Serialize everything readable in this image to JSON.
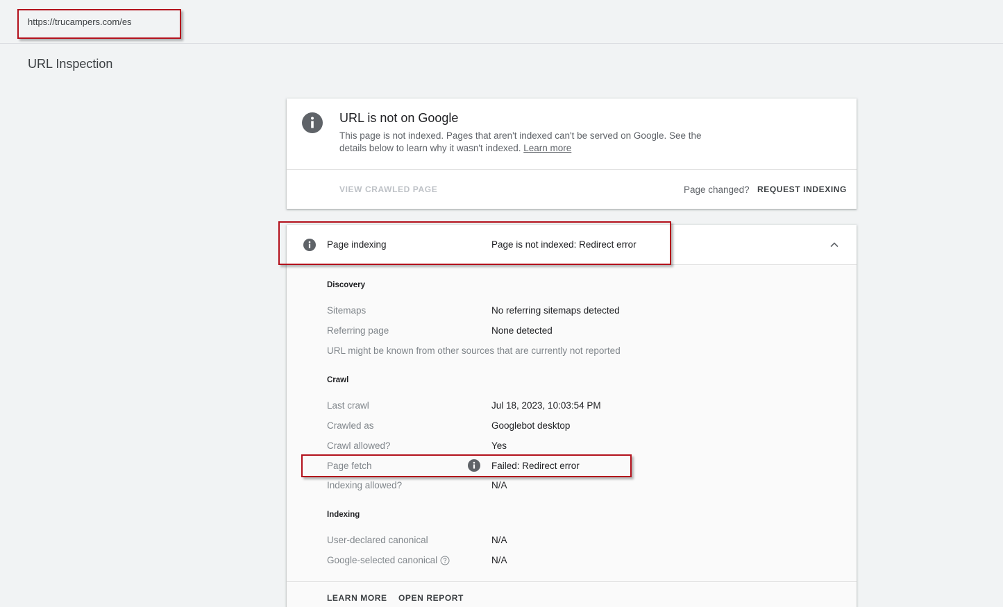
{
  "url_bar": {
    "value": "https://trucampers.com/es"
  },
  "page_title": "URL Inspection",
  "summary": {
    "heading": "URL is not on Google",
    "description": "This page is not indexed. Pages that aren't indexed can't be served on Google. See the details below to learn why it wasn't indexed.",
    "learn_more": "Learn more",
    "view_crawled": "VIEW CRAWLED PAGE",
    "page_changed": "Page changed?",
    "request_indexing": "REQUEST INDEXING",
    "icon": "info-icon"
  },
  "details": {
    "header_label": "Page indexing",
    "header_value": "Page is not indexed: Redirect error",
    "header_icon": "info-icon",
    "collapse_icon": "chevron-up-icon",
    "discovery": {
      "title": "Discovery",
      "rows": [
        {
          "label": "Sitemaps",
          "value": "No referring sitemaps detected"
        },
        {
          "label": "Referring page",
          "value": "None detected"
        }
      ],
      "note": "URL might be known from other sources that are currently not reported"
    },
    "crawl": {
      "title": "Crawl",
      "rows": [
        {
          "label": "Last crawl",
          "value": "Jul 18, 2023, 10:03:54 PM"
        },
        {
          "label": "Crawled as",
          "value": "Googlebot desktop"
        },
        {
          "label": "Crawl allowed?",
          "value": "Yes"
        },
        {
          "label": "Page fetch",
          "value": "Failed: Redirect error"
        },
        {
          "label": "Indexing allowed?",
          "value": "N/A"
        }
      ]
    },
    "indexing": {
      "title": "Indexing",
      "rows": [
        {
          "label": "User-declared canonical",
          "value": "N/A"
        },
        {
          "label": "Google-selected canonical",
          "value": "N/A"
        }
      ]
    },
    "footer": {
      "learn_more": "LEARN MORE",
      "open_report": "OPEN REPORT"
    }
  },
  "colors": {
    "highlight_box": "#b3111c",
    "background": "#f1f3f4",
    "icon_gray": "#5f6368"
  }
}
